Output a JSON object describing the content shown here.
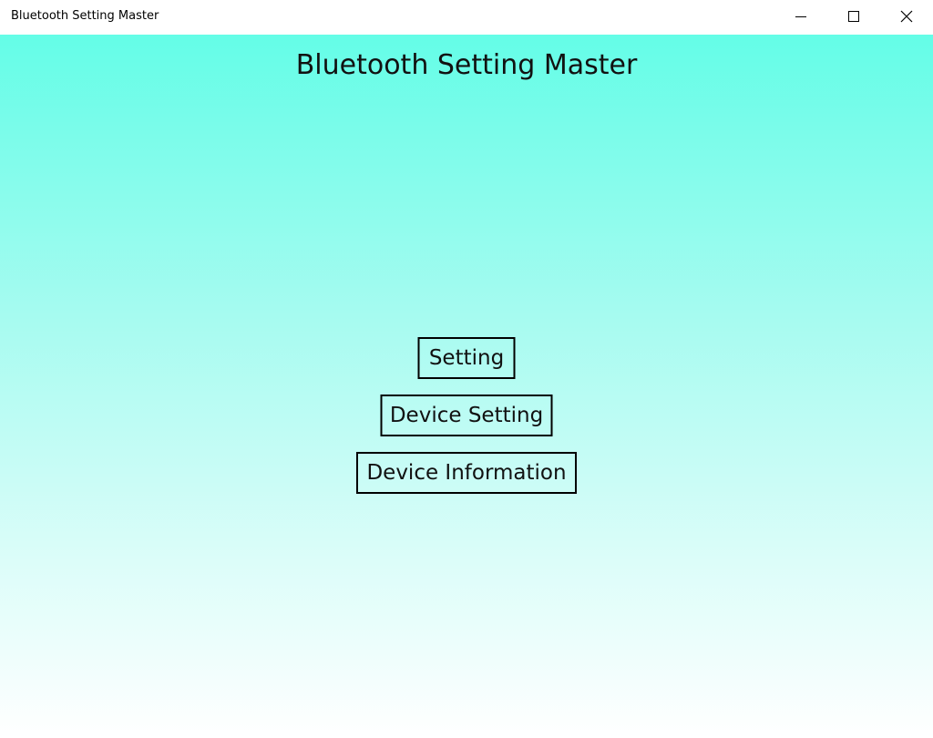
{
  "window": {
    "title": "Bluetooth Setting Master",
    "controls": {
      "minimize_icon": "minimize-icon",
      "maximize_icon": "maximize-icon",
      "close_icon": "close-icon"
    }
  },
  "app": {
    "title": "Bluetooth Setting Master",
    "background_top": "#64fde7",
    "background_bottom": "#ffffff"
  },
  "menu": {
    "setting_label": "Setting",
    "device_setting_label": "Device Setting",
    "device_information_label": "Device Information"
  }
}
